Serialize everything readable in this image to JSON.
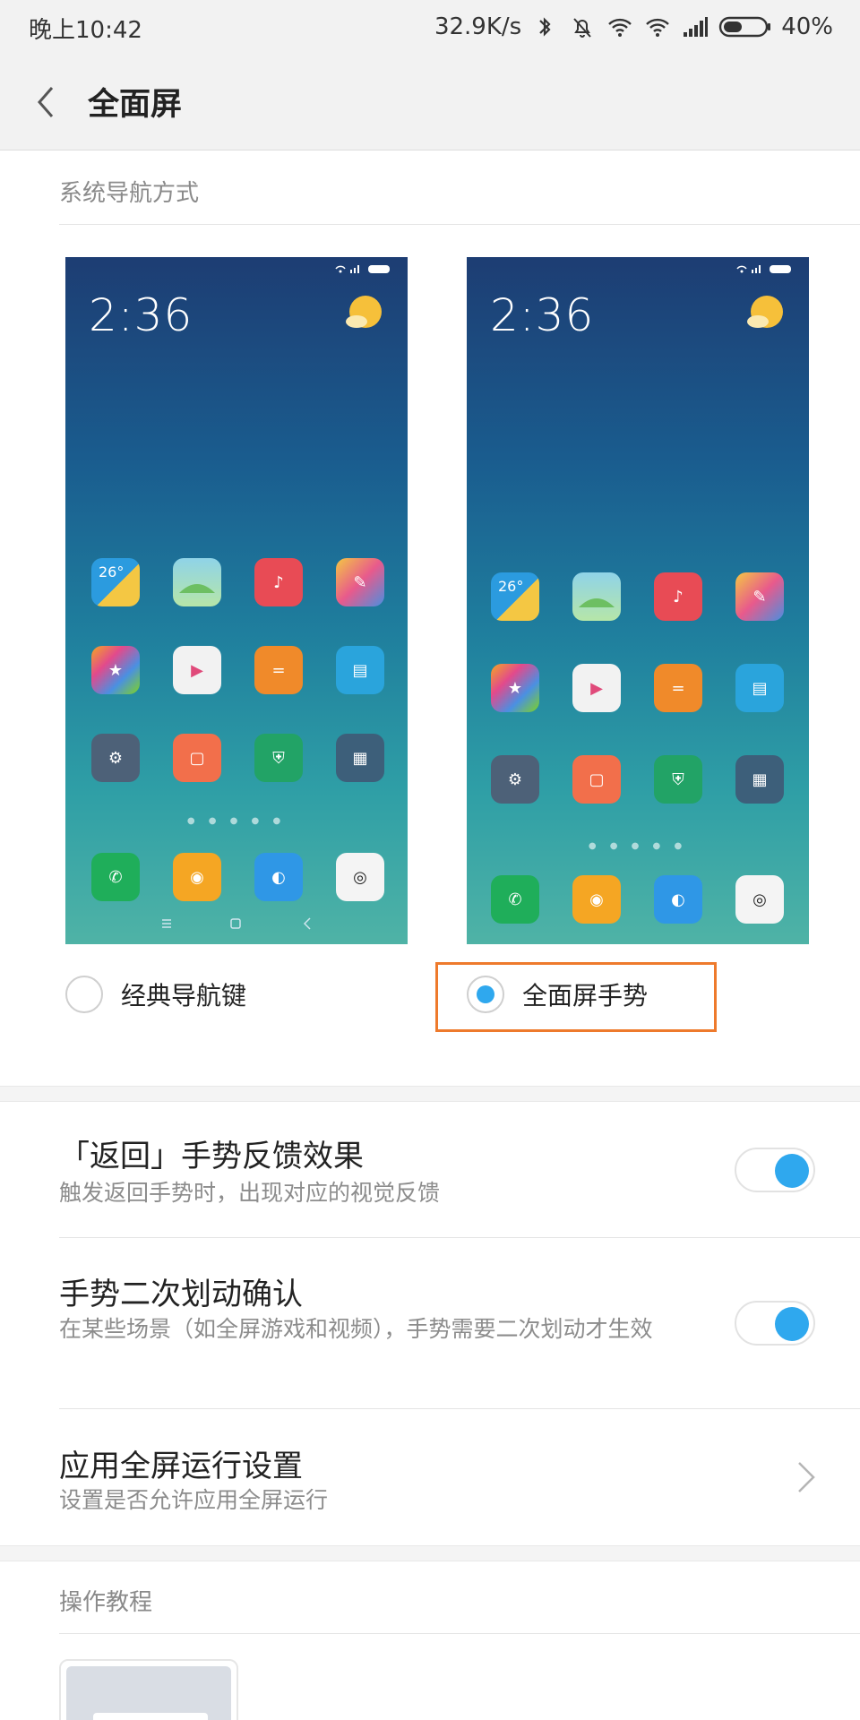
{
  "status_bar": {
    "time": "晚上10:42",
    "net_speed": "32.9K/s",
    "battery": "40%",
    "icons": [
      "bluetooth-icon",
      "mute-icon",
      "wifi-icon",
      "hotspot-icon",
      "signal-icon",
      "battery-icon"
    ]
  },
  "header": {
    "title": "全面屏"
  },
  "nav_section": {
    "label": "系统导航方式",
    "previews": [
      {
        "clock": "2:36",
        "weather_temp": "26°",
        "has_nav_buttons": true
      },
      {
        "clock": "2:36",
        "weather_temp": "26°",
        "has_nav_buttons": false
      }
    ],
    "options": [
      {
        "label": "经典导航键",
        "selected": false
      },
      {
        "label": "全面屏手势",
        "selected": true
      }
    ]
  },
  "settings": [
    {
      "title": "「返回」手势反馈效果",
      "subtitle": "触发返回手势时，出现对应的视觉反馈",
      "control": "toggle",
      "on": true
    },
    {
      "title": "手势二次划动确认",
      "subtitle": "在某些场景（如全屏游戏和视频），手势需要二次划动才生效",
      "control": "toggle",
      "on": true
    },
    {
      "title": "应用全屏运行设置",
      "subtitle": "设置是否允许应用全屏运行",
      "control": "chevron"
    }
  ],
  "tutorial_section": {
    "label": "操作教程"
  },
  "colors": {
    "accent": "#2fa8ee",
    "highlight": "#ee7a2c",
    "background": "#ffffff",
    "bar": "#f2f2f2"
  }
}
